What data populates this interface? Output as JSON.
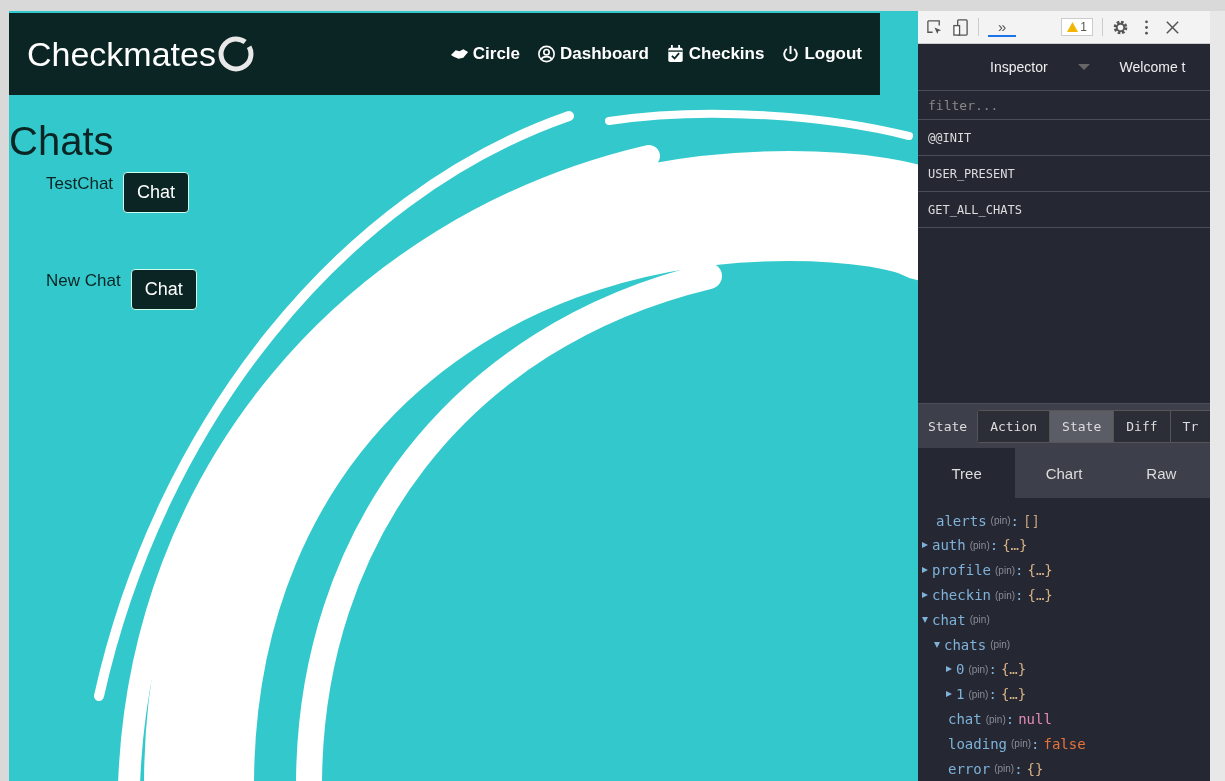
{
  "navbar": {
    "brand": "Checkmates",
    "links": [
      {
        "label": "Circle"
      },
      {
        "label": "Dashboard"
      },
      {
        "label": "Checkins"
      },
      {
        "label": "Logout"
      }
    ]
  },
  "page": {
    "heading": "Chats",
    "chats": [
      {
        "name": "TestChat",
        "button": "Chat"
      },
      {
        "name": "New Chat",
        "button": "Chat"
      }
    ]
  },
  "devtools": {
    "toolbar": {
      "more": "»",
      "warning_count": "1"
    },
    "inspector": {
      "title": "Inspector",
      "next_tab": "Welcome t"
    },
    "filter": {
      "placeholder": "filter..."
    },
    "actions": [
      {
        "label": "@@INIT"
      },
      {
        "label": "USER_PRESENT"
      },
      {
        "label": "GET_ALL_CHATS"
      }
    ],
    "monitor_label": "State",
    "monitor_tabs": [
      {
        "label": "Action",
        "selected": false
      },
      {
        "label": "State",
        "selected": true
      },
      {
        "label": "Diff",
        "selected": false
      },
      {
        "label": "Tr",
        "selected": false
      }
    ],
    "view_tabs": [
      {
        "label": "Tree",
        "selected": true
      },
      {
        "label": "Chart",
        "selected": false
      },
      {
        "label": "Raw",
        "selected": false
      }
    ],
    "tree": [
      {
        "kind": "leaf",
        "key": "alerts",
        "pin": "(pin)",
        "value": {
          "separator": ":",
          "color": "#c8a27a",
          "text": "[]"
        }
      },
      {
        "kind": "branch",
        "expanded": false,
        "key": "auth",
        "pin": "(pin)",
        "value": {
          "separator": ":",
          "color": "#d8b184",
          "text": "{…}"
        }
      },
      {
        "kind": "branch",
        "expanded": false,
        "key": "profile",
        "pin": "(pin)",
        "value": {
          "separator": ":",
          "color": "#d8b184",
          "text": "{…}"
        }
      },
      {
        "kind": "branch",
        "expanded": false,
        "key": "checkin",
        "pin": "(pin)",
        "value": {
          "separator": ":",
          "color": "#d8b184",
          "text": "{…}"
        }
      },
      {
        "kind": "branch",
        "expanded": true,
        "key": "chat",
        "pin": "(pin)",
        "children": [
          {
            "kind": "branch",
            "expanded": true,
            "key": "chats",
            "pin": "(pin)",
            "children": [
              {
                "kind": "branch",
                "expanded": false,
                "key": "0",
                "pin": "(pin)",
                "value": {
                  "separator": ":",
                  "color": "#d8b184",
                  "text": "{…}"
                }
              },
              {
                "kind": "branch",
                "expanded": false,
                "key": "1",
                "pin": "(pin)",
                "value": {
                  "separator": ":",
                  "color": "#d8b184",
                  "text": "{…}"
                }
              }
            ]
          },
          {
            "kind": "leaf",
            "key": "chat",
            "pin": "(pin)",
            "value": {
              "separator": ":",
              "color": "#e58bb7",
              "text": "null"
            }
          },
          {
            "kind": "leaf",
            "key": "loading",
            "pin": "(pin)",
            "value": {
              "separator": ":",
              "color": "#e8743b",
              "text": "false"
            }
          },
          {
            "kind": "leaf",
            "key": "error",
            "pin": "(pin)",
            "value": {
              "separator": ":",
              "color": "#d8b184",
              "text": "{}"
            }
          }
        ]
      }
    ]
  }
}
